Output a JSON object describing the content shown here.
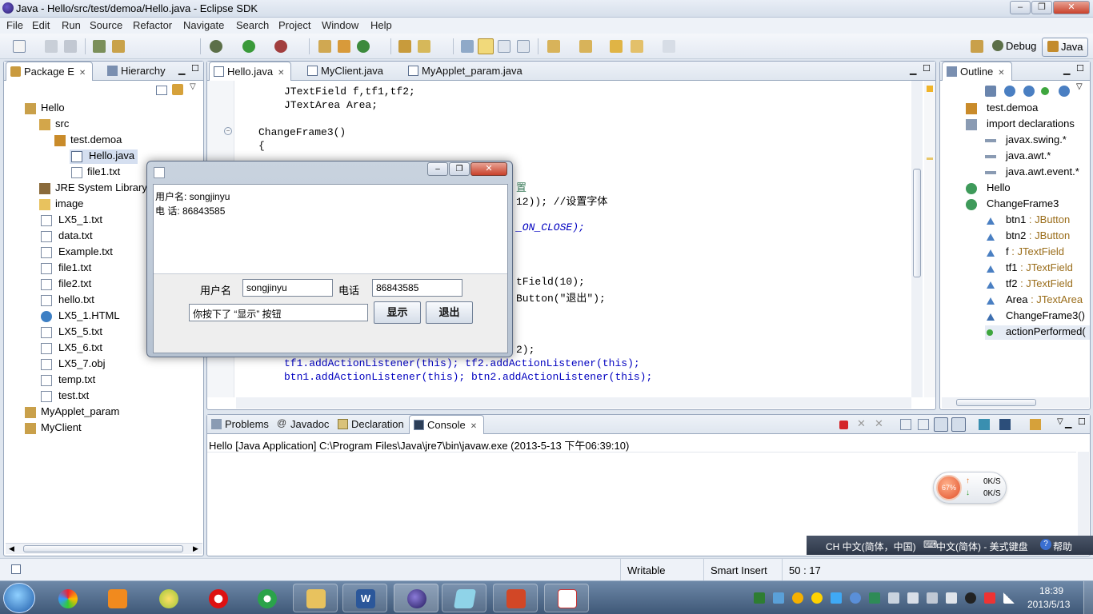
{
  "window": {
    "title": "Java - Hello/src/test/demoa/Hello.java - Eclipse SDK"
  },
  "menu": [
    "File",
    "Edit",
    "Run",
    "Source",
    "Refactor",
    "Navigate",
    "Search",
    "Project",
    "Window",
    "Help"
  ],
  "perspectives": {
    "debug": "Debug",
    "java": "Java"
  },
  "left_panel": {
    "tabs": [
      "Package E",
      "Hierarchy"
    ],
    "tree": [
      {
        "label": "Hello",
        "icon": "project-icon"
      },
      {
        "label": "src",
        "icon": "source-folder-icon"
      },
      {
        "label": "test.demoa",
        "icon": "package-icon"
      },
      {
        "label": "Hello.java",
        "icon": "java-file-icon"
      },
      {
        "label": "file1.txt",
        "icon": "file-icon"
      },
      {
        "label": "JRE System Library",
        "icon": "library-icon"
      },
      {
        "label": "image",
        "icon": "folder-icon"
      },
      {
        "label": "LX5_1.txt",
        "icon": "file-icon"
      },
      {
        "label": "data.txt",
        "icon": "file-icon"
      },
      {
        "label": "Example.txt",
        "icon": "file-icon"
      },
      {
        "label": "file1.txt",
        "icon": "file-icon"
      },
      {
        "label": "file2.txt",
        "icon": "file-icon"
      },
      {
        "label": "hello.txt",
        "icon": "file-icon"
      },
      {
        "label": "LX5_1.HTML",
        "icon": "html-file-icon"
      },
      {
        "label": "LX5_5.txt",
        "icon": "file-icon"
      },
      {
        "label": "LX5_6.txt",
        "icon": "file-icon"
      },
      {
        "label": "LX5_7.obj",
        "icon": "file-icon"
      },
      {
        "label": "temp.txt",
        "icon": "file-icon"
      },
      {
        "label": "test.txt",
        "icon": "file-icon"
      },
      {
        "label": "MyApplet_param",
        "icon": "project-icon"
      },
      {
        "label": "MyClient",
        "icon": "project-icon"
      }
    ]
  },
  "editor": {
    "tabs": [
      "Hello.java",
      "MyClient.java",
      "MyApplet_param.java"
    ],
    "lines": [
      {
        "text": "JTextField f,tf1,tf2;"
      },
      {
        "text": "JTextArea Area;"
      },
      {
        "text": "ChangeFrame3()"
      },
      {
        "text": "{"
      },
      {
        "text": "置"
      },
      {
        "text": "12)); //设置字体"
      },
      {
        "text": "_ON_CLOSE);"
      },
      {
        "text": "tField(10);"
      },
      {
        "text": "Button(\"退出\");"
      },
      {
        "text": "2);"
      },
      {
        "text": "tf1.addActionListener(this); tf2.addActionListener(this);"
      },
      {
        "text": "btn1.addActionListener(this); btn2.addActionListener(this);"
      }
    ]
  },
  "outline": {
    "tab": "Outline",
    "items": [
      {
        "label": "test.demoa",
        "type": ""
      },
      {
        "label": "import declarations",
        "type": ""
      },
      {
        "label": "javax.swing.*",
        "type": ""
      },
      {
        "label": "java.awt.*",
        "type": ""
      },
      {
        "label": "java.awt.event.*",
        "type": ""
      },
      {
        "label": "Hello",
        "type": ""
      },
      {
        "label": "ChangeFrame3",
        "type": ""
      },
      {
        "label": "btn1",
        "type": " : JButton"
      },
      {
        "label": "btn2",
        "type": " : JButton"
      },
      {
        "label": "f",
        "type": " : JTextField"
      },
      {
        "label": "tf1",
        "type": " : JTextField"
      },
      {
        "label": "tf2",
        "type": " : JTextField"
      },
      {
        "label": "Area",
        "type": " : JTextArea"
      },
      {
        "label": "ChangeFrame3()",
        "type": ""
      },
      {
        "label": "actionPerformed(",
        "type": ""
      }
    ]
  },
  "bottom_panel": {
    "tabs": [
      "Problems",
      "Javadoc",
      "Declaration",
      "Console"
    ],
    "console_header": "Hello [Java Application] C:\\Program Files\\Java\\jre7\\bin\\javaw.exe (2013-5-13 下午06:39:10)"
  },
  "dialog": {
    "area_line1": "用户名: songjinyu",
    "area_line2": "电 话: 86843585",
    "user_label": "用户名",
    "user_value": "songjinyu",
    "phone_label": "电话",
    "phone_value": "86843585",
    "status_value": "你按下了 “显示” 按钮",
    "show_button": "显示",
    "exit_button": "退出"
  },
  "net_widget": {
    "percent": "67%",
    "up": "0K/S",
    "down": "0K/S"
  },
  "language_bar": {
    "lang": "CH 中文(简体，中国)",
    "ime": "中文(简体) - 美式键盘",
    "help": "帮助"
  },
  "status": {
    "writable": "Writable",
    "insert": "Smart Insert",
    "position": "50 : 17"
  },
  "clock": {
    "time": "18:39",
    "date": "2013/5/13"
  }
}
